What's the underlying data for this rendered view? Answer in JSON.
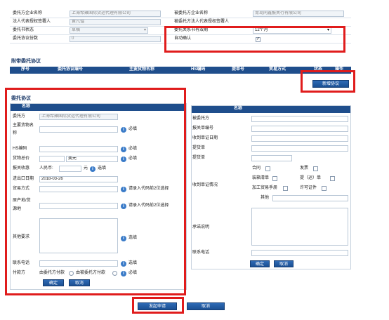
{
  "top": {
    "client_name_label": "委托方企业名称",
    "client_name_value": "上海希雍国际货运代理有限公司",
    "trustee_name_label": "被委托方企业名称",
    "trustee_name_value": "青岛同鑫报关行有限公司",
    "legal_rep_label": "法人代表授权签署人",
    "legal_rep_value": "黄凡镭",
    "trustee_legal_label": "被委托方法人代表授权签署人",
    "status_label": "委托书状态",
    "status_value": "草稿",
    "validity_label": "委托关系书有效期",
    "validity_value": "12个月",
    "count_label": "委托协议份数",
    "count_value": "0",
    "auto_confirm_label": "自动确认"
  },
  "attached": {
    "title": "附带委托协议",
    "columns": [
      "序号",
      "委托协议编号",
      "主要货物名称",
      "HS编码",
      "提单号",
      "贸易方式",
      "状态",
      "操作"
    ],
    "new_button": "新增协议"
  },
  "agreement": {
    "title": "委托协议",
    "left_header": "名称",
    "client_label": "委托方",
    "client_value": "上海希雍国际货运代理有限公司",
    "goods_label_1": "主要货物名",
    "goods_label_2": "称",
    "required": "必填",
    "hs_label": "HS编码",
    "goods_value_label": "货物总价",
    "currency": "美元",
    "declared_label": "报关收惠",
    "rmb_label": "人民币:",
    "yuan": "元",
    "optional": "选填",
    "import_export_label": "进出口日期",
    "import_export_value": "2018-03-26",
    "trade_mode_label": "贸易方式",
    "trade_mode_hint": "请录入代码前2位选择",
    "origin_label_1": "原产地/货",
    "origin_label_2": "源地",
    "origin_hint": "请录入代码前2位选择",
    "other_label": "其他要求",
    "phone_label": "联系电话",
    "payer_label": "付款方",
    "payer_opt1": "由委托方付款",
    "payer_opt2": "由被委托方付款",
    "confirm": "确定",
    "cancel": "取消"
  },
  "right": {
    "header": "名称",
    "trustee_label": "被委托方",
    "decl_no_label": "报关单编号",
    "receipt_date_label": "收到单证日期",
    "bl_label": "提货单",
    "bl2_label": "提货单",
    "docs_label": "收到单证情况",
    "contract": "合同",
    "invoice": "发票",
    "packing": "装箱清单",
    "bill": "提（运）单",
    "processing": "加工贸易手册",
    "license": "许可证件",
    "other": "其他",
    "remarks_label": "承诺说明",
    "phone_label": "联系电话",
    "confirm": "确定",
    "cancel": "取消"
  },
  "footer": {
    "submit": "发起申请",
    "cancel": "取消"
  },
  "colors": {
    "accent": "#1f4e8c",
    "highlight": "#e01c1c"
  }
}
